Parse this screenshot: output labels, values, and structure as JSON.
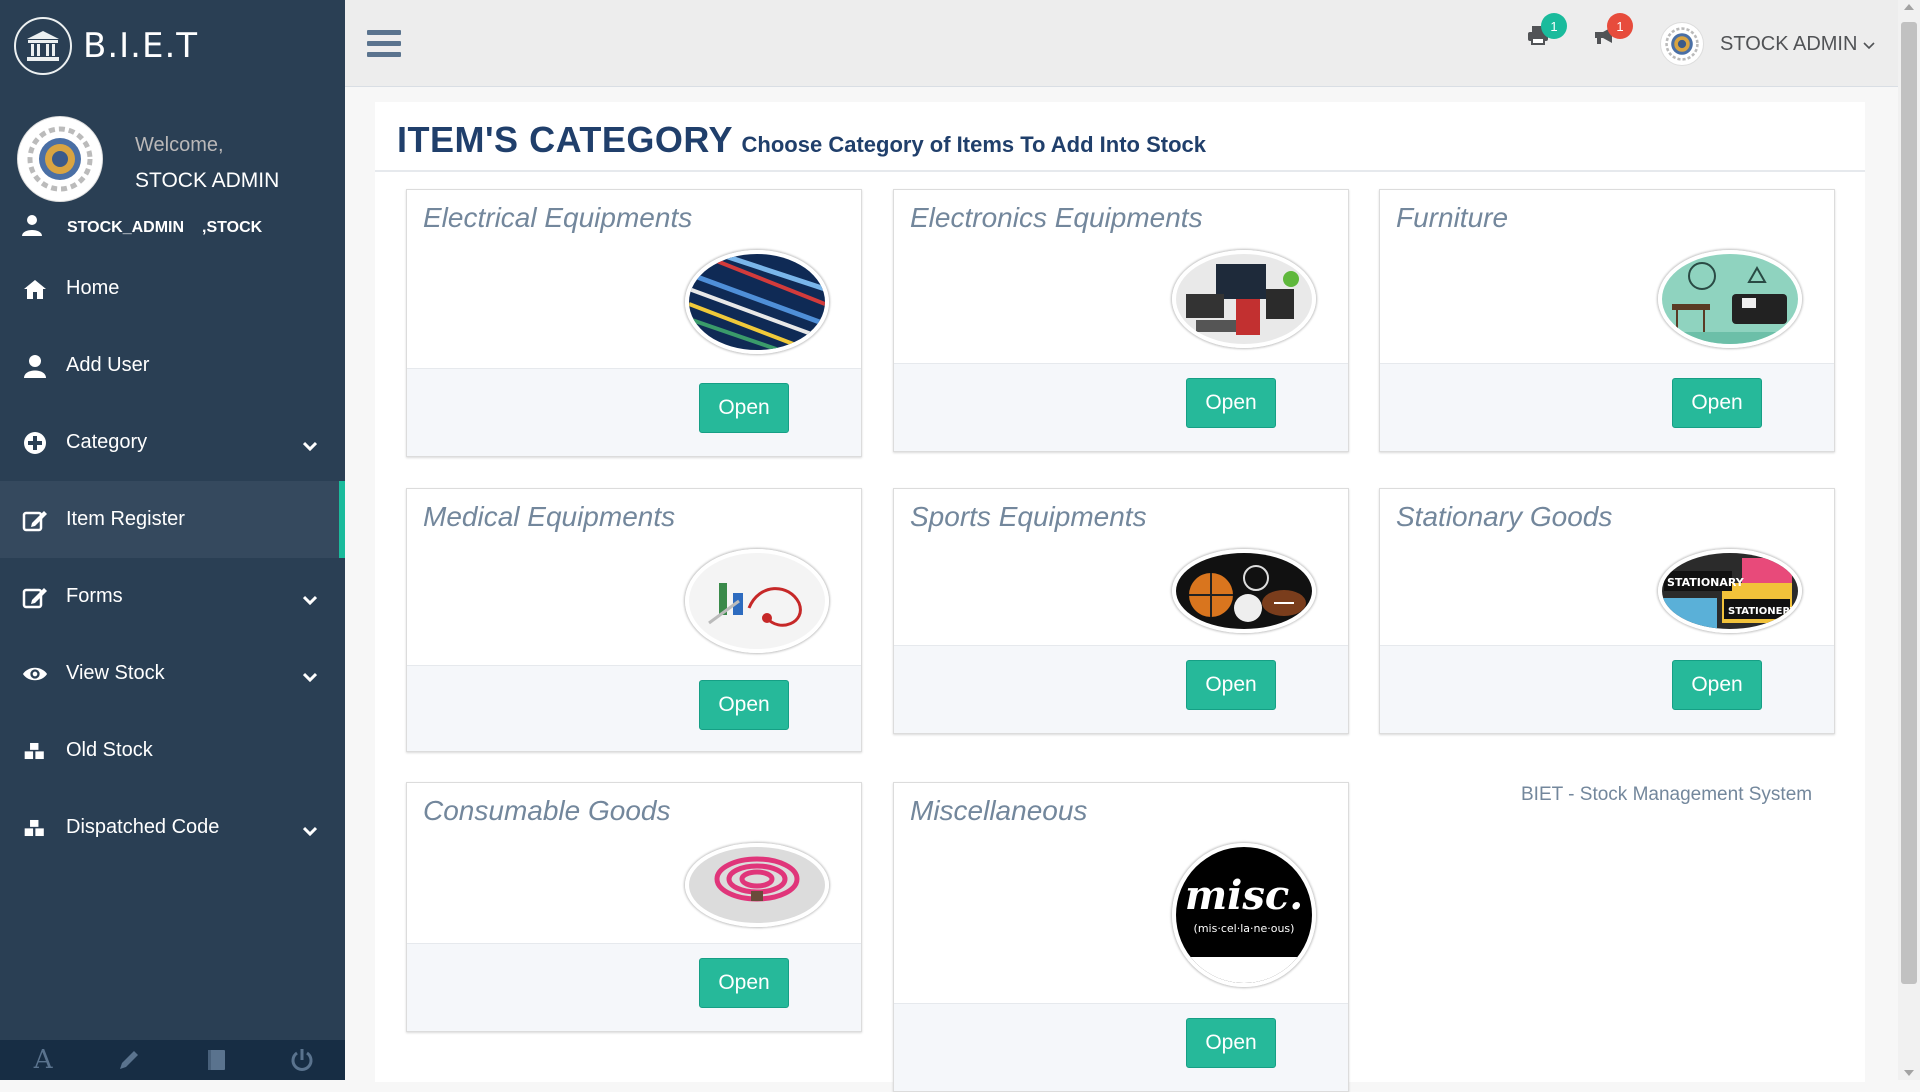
{
  "brand": {
    "title": "B.I.E.T"
  },
  "profile": {
    "welcome": "Welcome,",
    "name": "STOCK ADMIN",
    "role1": "STOCK_ADMIN",
    "role2": ",STOCK"
  },
  "menu": [
    {
      "label": "Home",
      "icon": "home-icon"
    },
    {
      "label": "Add User",
      "icon": "user-icon"
    },
    {
      "label": "Category",
      "icon": "plus-circle-icon",
      "dropdown": true
    },
    {
      "label": "Item Register",
      "icon": "edit-icon",
      "active": true
    },
    {
      "label": "Forms",
      "icon": "edit-icon",
      "dropdown": true
    },
    {
      "label": "View Stock",
      "icon": "eye-icon",
      "dropdown": true
    },
    {
      "label": "Old Stock",
      "icon": "cubes-icon"
    },
    {
      "label": "Dispatched Code",
      "icon": "cubes-icon",
      "dropdown": true
    }
  ],
  "footer_icons": [
    "font-icon",
    "pencil-icon",
    "book-icon",
    "power-icon"
  ],
  "topnav": {
    "notif1_count": "1",
    "notif2_count": "1",
    "user_name": "STOCK ADMIN"
  },
  "page": {
    "title": "ITEM'S CATEGORY",
    "subtitle": "Choose Category of Items To Add Into Stock",
    "footer": "BIET - Stock Management System"
  },
  "categories": [
    {
      "title": "Electrical Equipments",
      "button": "Open"
    },
    {
      "title": "Electronics Equipments",
      "button": "Open"
    },
    {
      "title": "Furniture",
      "button": "Open"
    },
    {
      "title": "Medical Equipments",
      "button": "Open"
    },
    {
      "title": "Sports Equipments",
      "button": "Open"
    },
    {
      "title": "Stationary Goods",
      "button": "Open",
      "image_text1": "STATIONARY",
      "image_text2": "STATIONERY"
    },
    {
      "title": "Consumable Goods",
      "button": "Open"
    },
    {
      "title": "Miscellaneous",
      "button": "Open",
      "image_text1": "misc.",
      "image_text2": "(mis·cel·la·ne·ous)"
    }
  ],
  "colors": {
    "sidebar": "#2a3f54",
    "accent": "#26B99A",
    "title": "#203f6b",
    "badge_green": "#1ABB9C",
    "badge_red": "#E74C3C"
  }
}
